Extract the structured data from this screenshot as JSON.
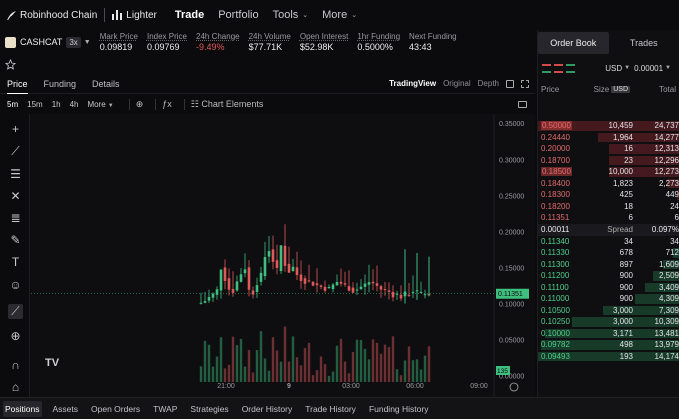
{
  "nav": {
    "chain": "Robinhood Chain",
    "brand": "Lighter",
    "items": [
      {
        "label": "Trade",
        "active": true,
        "dropdown": false
      },
      {
        "label": "Portfolio",
        "active": false,
        "dropdown": false
      },
      {
        "label": "Tools",
        "active": false,
        "dropdown": true
      },
      {
        "label": "More",
        "active": false,
        "dropdown": true
      }
    ]
  },
  "ticker": {
    "symbol": "CASHCAT",
    "leverage": "3x",
    "stats": [
      {
        "label": "Mark Price",
        "value": "0.09819",
        "neg": false
      },
      {
        "label": "Index Price",
        "value": "0.09769",
        "neg": false
      },
      {
        "label": "24h Change",
        "value": "-9.49%",
        "neg": true
      },
      {
        "label": "24h Volume",
        "value": "$77.71K",
        "neg": false
      },
      {
        "label": "Open Interest",
        "value": "$52.98K",
        "neg": false
      },
      {
        "label": "1hr Funding",
        "value": "0.5000%",
        "neg": false
      },
      {
        "label": "Next Funding",
        "value": "43:43",
        "neg": false
      }
    ]
  },
  "chart_tabs": {
    "tabs": [
      "Price",
      "Funding",
      "Details"
    ],
    "views": [
      "TradingView",
      "Original",
      "Depth"
    ]
  },
  "toolbar": {
    "timeframes": [
      "5m",
      "15m",
      "1h",
      "4h"
    ],
    "more": "More",
    "chart_elements": "Chart Elements"
  },
  "chart_data": {
    "type": "candlestick",
    "y_ticks": [
      "0.35000",
      "0.30000",
      "0.25000",
      "0.20000",
      "0.15000",
      "0.10000",
      "0.05000",
      "0.00000"
    ],
    "x_ticks": [
      "21:00",
      "9",
      "03:00",
      "06:00",
      "09:00"
    ],
    "ylim": [
      -0.02,
      0.36
    ],
    "last_price": "0.11351",
    "last_price_value": 0.1135,
    "volume_label": "135",
    "up_color": "#3fbf7f",
    "down_color": "#e05a5a"
  },
  "orderbook": {
    "tabs": [
      "Order Book",
      "Trades"
    ],
    "currency": "USD",
    "tick": "0.00001",
    "headers": {
      "price": "Price",
      "size": "Size",
      "usd": "USD",
      "total": "Total"
    },
    "asks": [
      {
        "price": "0.50000",
        "size": "10,459",
        "total": "24,737",
        "depth": 1.0
      },
      {
        "price": "0.24440",
        "size": "1,964",
        "total": "14,277",
        "depth": 0.58
      },
      {
        "price": "0.20000",
        "size": "16",
        "total": "12,313",
        "depth": 0.5
      },
      {
        "price": "0.18700",
        "size": "23",
        "total": "12,296",
        "depth": 0.5
      },
      {
        "price": "0.18500",
        "size": "10,000",
        "total": "12,273",
        "depth": 0.5
      },
      {
        "price": "0.18400",
        "size": "1,823",
        "total": "2,273",
        "depth": 0.09
      },
      {
        "price": "0.18300",
        "size": "425",
        "total": "449",
        "depth": 0.02
      },
      {
        "price": "0.18200",
        "size": "18",
        "total": "24",
        "depth": 0.01
      },
      {
        "price": "0.11351",
        "size": "6",
        "total": "6",
        "depth": 0.005
      }
    ],
    "spread": {
      "price": "0.00011",
      "label": "Spread",
      "pct": "0.097%"
    },
    "bids": [
      {
        "price": "0.11340",
        "size": "34",
        "total": "34",
        "depth": 0.01
      },
      {
        "price": "0.11330",
        "size": "678",
        "total": "712",
        "depth": 0.05
      },
      {
        "price": "0.11300",
        "size": "897",
        "total": "1,609",
        "depth": 0.12
      },
      {
        "price": "0.11200",
        "size": "900",
        "total": "2,509",
        "depth": 0.19
      },
      {
        "price": "0.11100",
        "size": "900",
        "total": "3,409",
        "depth": 0.25
      },
      {
        "price": "0.11000",
        "size": "900",
        "total": "4,309",
        "depth": 0.32
      },
      {
        "price": "0.10500",
        "size": "3,000",
        "total": "7,309",
        "depth": 0.54
      },
      {
        "price": "0.10250",
        "size": "3,000",
        "total": "10,309",
        "depth": 0.76
      },
      {
        "price": "0.10000",
        "size": "3,171",
        "total": "13,481",
        "depth": 0.95
      },
      {
        "price": "0.09782",
        "size": "498",
        "total": "13,979",
        "depth": 0.98
      },
      {
        "price": "0.09493",
        "size": "193",
        "total": "14,174",
        "depth": 1.0
      }
    ]
  },
  "bottom_tabs": [
    "Positions",
    "Assets",
    "Open Orders",
    "TWAP",
    "Strategies",
    "Order History",
    "Trade History",
    "Funding History"
  ]
}
